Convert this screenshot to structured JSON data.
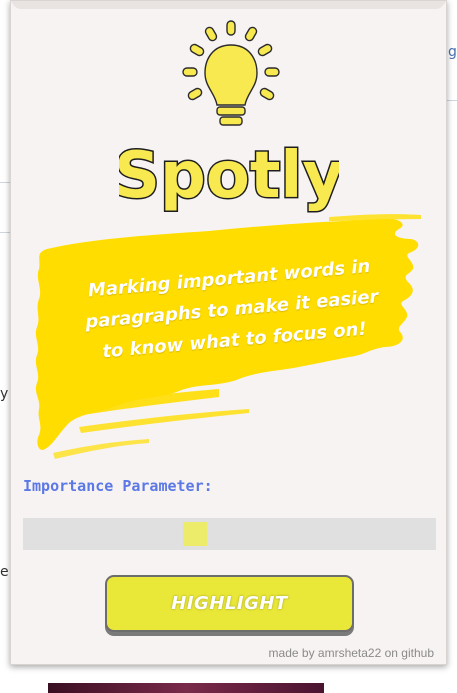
{
  "background": {
    "right_fragment": "g",
    "left_fragment_1": "y",
    "left_fragment_2": "e"
  },
  "popup": {
    "title": "Spotly",
    "tagline": "Marking important words in\nparagraphs  to make it easier\nto know what to focus on!",
    "param_label": "Importance Parameter:",
    "slider": {
      "value": 0.412
    },
    "button_label": "HIGHLIGHT",
    "credit": "made by amrsheta22 on github",
    "colors": {
      "accent_yellow": "#ffdd00",
      "bulb_yellow": "#f7e94f",
      "label_blue": "#5b78e6",
      "button_yellow": "#e9e737"
    },
    "icons": [
      "lightbulb-icon"
    ]
  }
}
